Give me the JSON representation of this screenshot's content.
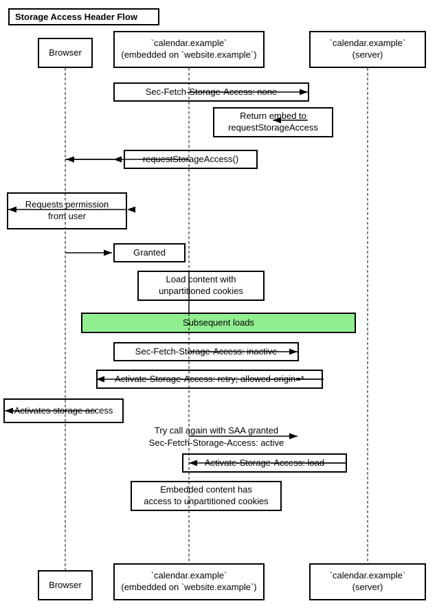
{
  "title": "Storage Access Header Flow",
  "boxes": {
    "browser_top": "Browser",
    "calendar_embedded_top": "`calendar.example`\n(embedded on `website.example`)",
    "calendar_server_top": "`calendar.example`\n(server)",
    "sec_fetch_none": "Sec-Fetch-Storage-Access: none",
    "return_embed": "Return embed to\nrequestStorageAccess",
    "request_storage_access": "requestStorageAccess()",
    "requests_permission": "Requests permission\nfrom user",
    "granted": "Granted",
    "load_content": "Load content with\nunpartitioned cookies",
    "subsequent_loads": "Subsequent loads",
    "sec_fetch_inactive": "Sec-Fetch-Storage-Access: inactive",
    "activate_storage_retry": "Activate-Storage-Access: retry; allowed-origin=*",
    "activates_storage": "Activates storage access",
    "try_call_again": "Try call again with SAA granted\nSec-Fetch-Storage-Access: active",
    "activate_storage_load": "Activate-Storage-Access: load",
    "embedded_content_has": "Embedded content has\naccess to unpartitioned cookies",
    "browser_bottom": "Browser",
    "calendar_embedded_bottom": "`calendar.example`\n(embedded on `website.example`)",
    "calendar_server_bottom": "`calendar.example`\n(server)"
  }
}
